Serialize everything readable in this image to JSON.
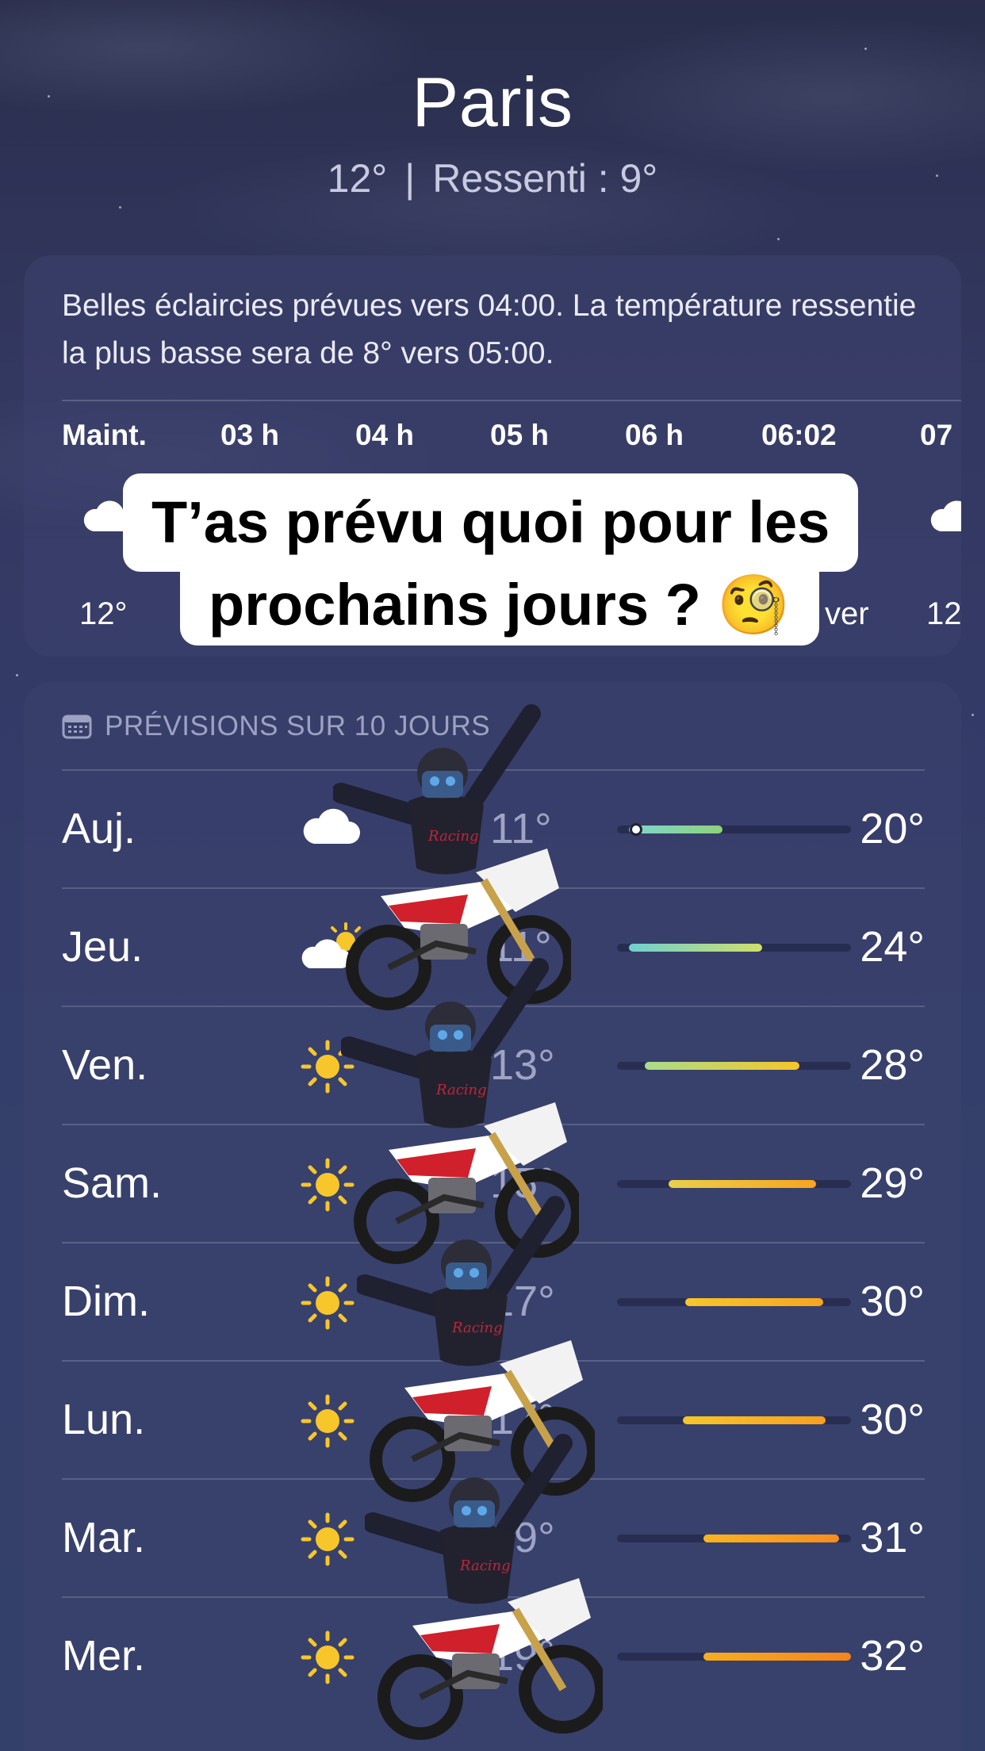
{
  "header": {
    "city": "Paris",
    "current_temp": "12°",
    "separator": "|",
    "feels_like": "Ressenti : 9°"
  },
  "hourly": {
    "description": "Belles éclaircies prévues vers 04:00. La température ressentie la plus basse sera de 8° vers 05:00.",
    "hours": [
      {
        "label": "Maint.",
        "temp": "12°",
        "icon": "cloud-icon"
      },
      {
        "label": "03 h",
        "temp": "",
        "icon": ""
      },
      {
        "label": "04 h",
        "temp": "",
        "icon": ""
      },
      {
        "label": "05 h",
        "temp": "",
        "icon": ""
      },
      {
        "label": "06 h",
        "temp": "",
        "icon": ""
      },
      {
        "label": "06:02",
        "temp": "ver",
        "icon": ""
      },
      {
        "label": "07",
        "temp": "12",
        "icon": "cloud-icon"
      }
    ]
  },
  "caption": {
    "line1": "T’as prévu quoi pour les",
    "line2": "prochains jours ? 🧐"
  },
  "daily": {
    "title": "PRÉVISIONS SUR 10 JOURS",
    "icon": "calendar-icon",
    "days": [
      {
        "day": "Auj.",
        "icon": "cloud-icon",
        "min": "11°",
        "max": "20°",
        "bar": [
          0.05,
          0.45
        ],
        "current": 0.08,
        "colors": [
          "#7ed6d0",
          "#8ed27a"
        ]
      },
      {
        "day": "Jeu.",
        "icon": "partly-sunny-icon",
        "min": "11°",
        "max": "24°",
        "bar": [
          0.05,
          0.62
        ],
        "colors": [
          "#6fd0cf",
          "#cfe06a"
        ]
      },
      {
        "day": "Ven.",
        "icon": "sun-icon",
        "min": "13°",
        "max": "28°",
        "bar": [
          0.12,
          0.78
        ],
        "colors": [
          "#a9dc8a",
          "#f6c629"
        ]
      },
      {
        "day": "Sam.",
        "icon": "sun-icon",
        "min": "15°",
        "max": "29°",
        "bar": [
          0.22,
          0.85
        ],
        "colors": [
          "#e9d048",
          "#f8a51e"
        ]
      },
      {
        "day": "Dim.",
        "icon": "sun-icon",
        "min": "17°",
        "max": "30°",
        "bar": [
          0.29,
          0.88
        ],
        "colors": [
          "#f7c62a",
          "#f8a51e"
        ]
      },
      {
        "day": "Lun.",
        "icon": "sun-icon",
        "min": "17°",
        "max": "30°",
        "bar": [
          0.28,
          0.89
        ],
        "colors": [
          "#f7c62a",
          "#f7a01e"
        ]
      },
      {
        "day": "Mar.",
        "icon": "sun-icon",
        "min": "19°",
        "max": "31°",
        "bar": [
          0.37,
          0.95
        ],
        "colors": [
          "#f8b520",
          "#f78c1e"
        ]
      },
      {
        "day": "Mer.",
        "icon": "sun-icon",
        "min": "19°",
        "max": "32°",
        "bar": [
          0.37,
          1.0
        ],
        "colors": [
          "#f8ad1f",
          "#f6841c"
        ]
      }
    ]
  }
}
